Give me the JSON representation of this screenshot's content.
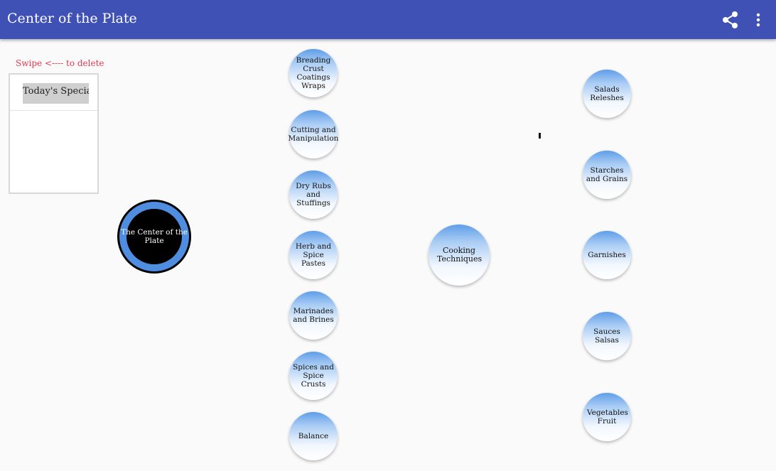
{
  "appbar": {
    "title": "Center of the Plate",
    "share_icon": "share-icon",
    "more_icon": "more-vert-icon"
  },
  "sidebar": {
    "hint": "Swipe <---- to delete",
    "items": [
      {
        "label": "Today's Special"
      }
    ]
  },
  "center_node": {
    "label": "The Center of the Plate"
  },
  "middle_column": [
    {
      "label": "Breading Crust Coatings Wraps"
    },
    {
      "label": "Cutting and Manipulation"
    },
    {
      "label": "Dry Rubs and Stuffings"
    },
    {
      "label": "Herb and Spice Pastes"
    },
    {
      "label": "Marinades and Brines"
    },
    {
      "label": "Spices and Spice Crusts"
    },
    {
      "label": "Balance"
    }
  ],
  "hub_node": {
    "label": "Cooking Techniques"
  },
  "right_column": [
    {
      "label": "Salads Releshes"
    },
    {
      "label": "Starches and Grains"
    },
    {
      "label": "Garnishes"
    },
    {
      "label": "Sauces Salsas"
    },
    {
      "label": "Vegetables Fruit"
    }
  ],
  "colors": {
    "appbar": "#3f51b5",
    "hint": "#e53950",
    "node_blue": "#5f9ee8",
    "ring_blue": "#4e8de0"
  }
}
